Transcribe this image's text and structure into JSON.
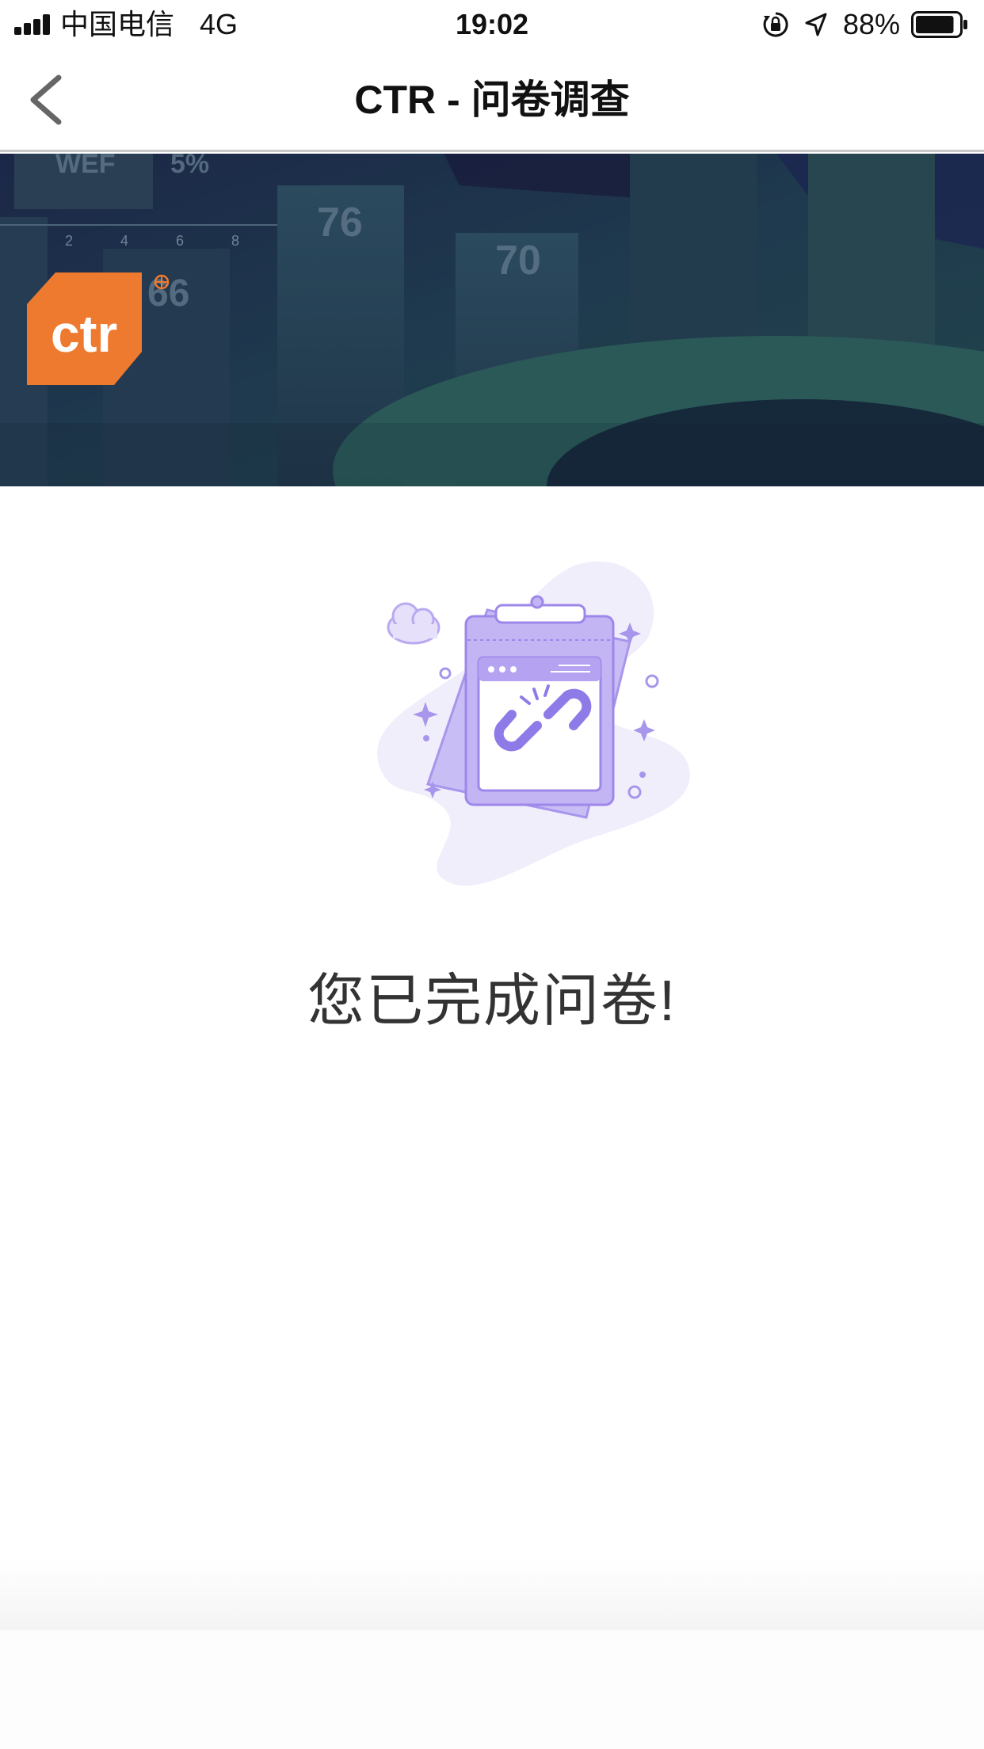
{
  "status_bar": {
    "carrier": "中国电信",
    "network": "4G",
    "time": "19:02",
    "battery_percent": "88%",
    "battery_level": 0.88
  },
  "nav": {
    "title": "CTR - 问卷调查",
    "back_icon": "chevron-left-icon"
  },
  "banner": {
    "logo_text": "ctr",
    "logo_color": "#ee7a2f",
    "background_numbers": [
      "WEF",
      "5%",
      "76",
      "70",
      "66"
    ]
  },
  "illustration": {
    "icon": "broken-link-icon",
    "accent_color": "#8f7be8"
  },
  "message": {
    "text": "您已完成问卷!"
  }
}
